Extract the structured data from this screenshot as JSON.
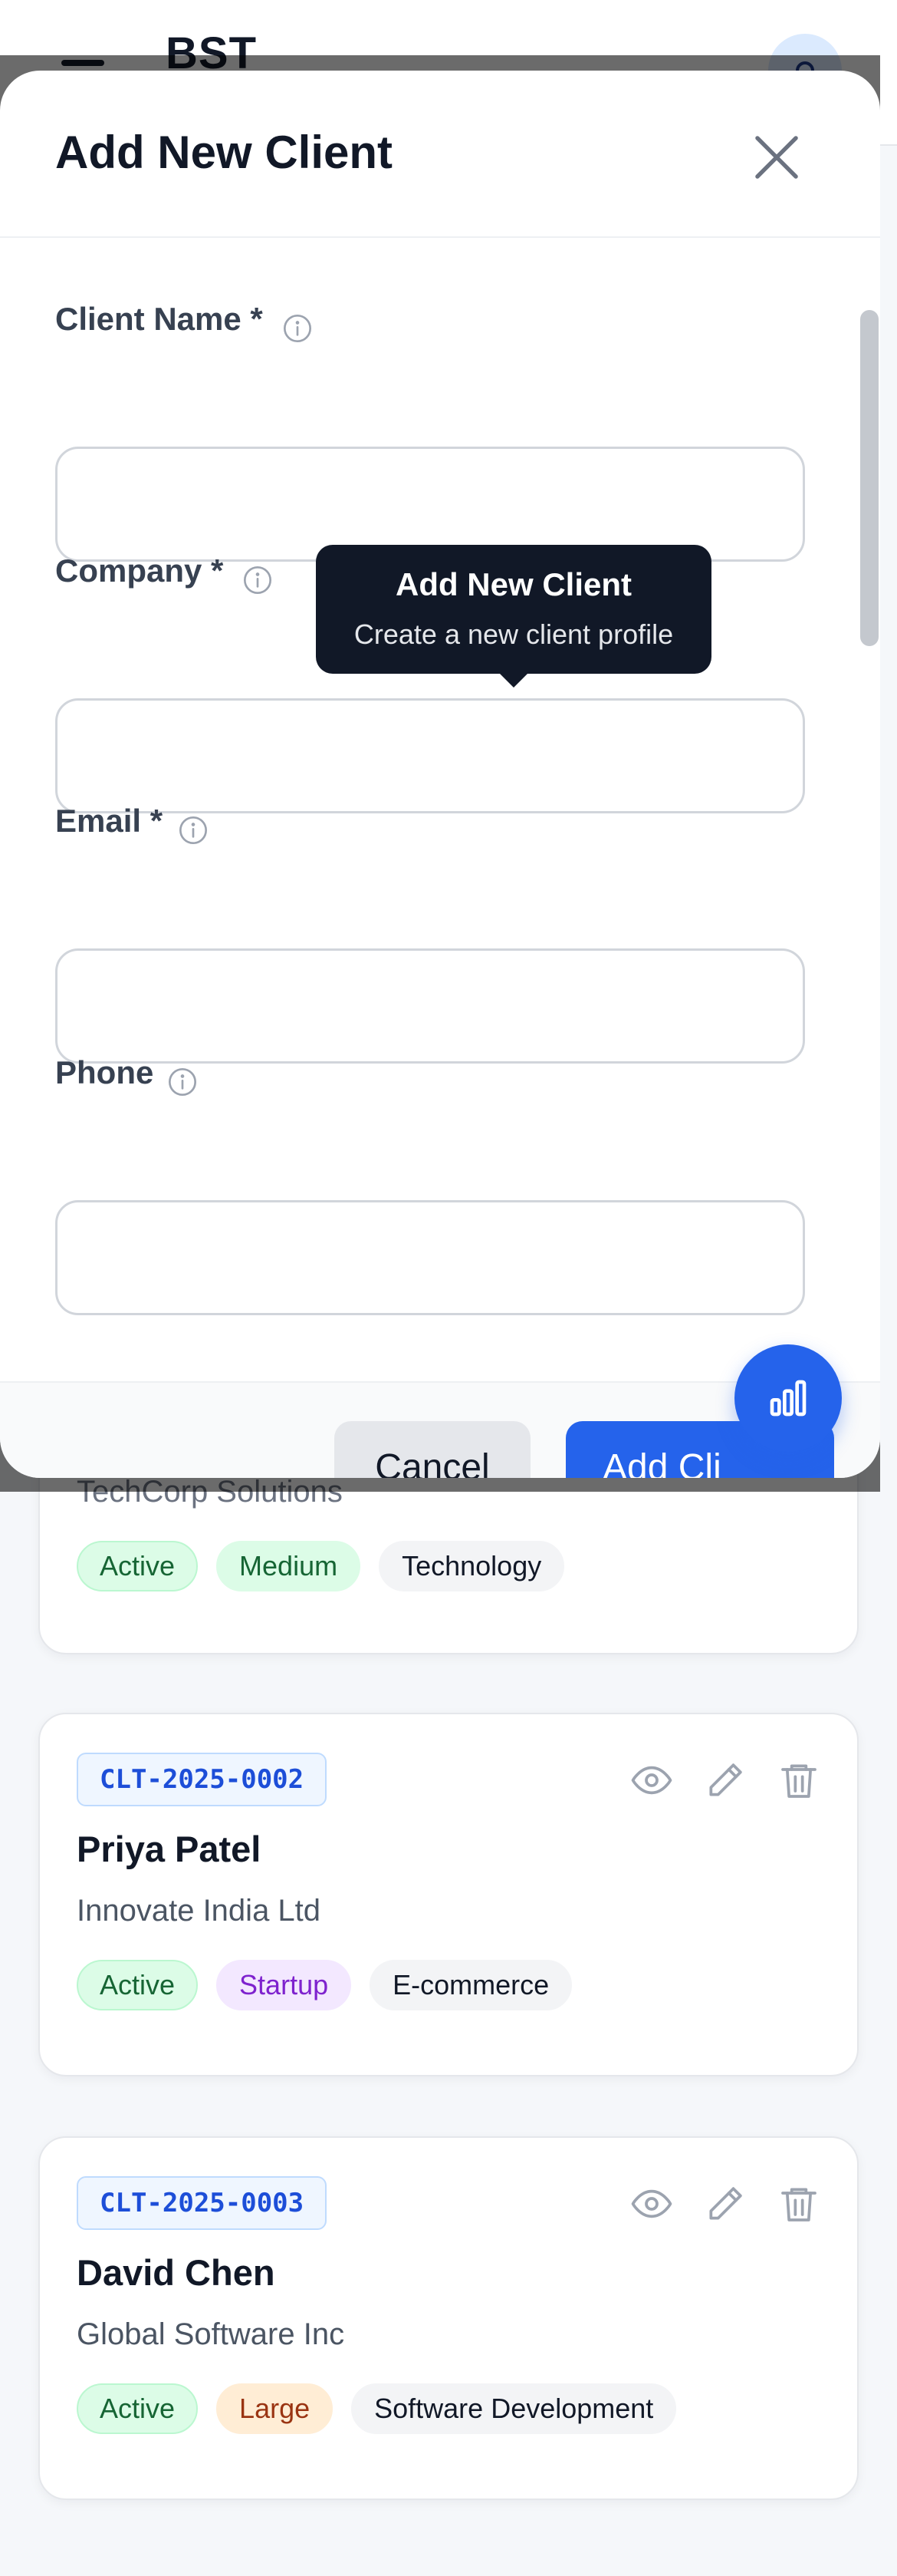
{
  "app": {
    "brand": "BST"
  },
  "modal": {
    "title": "Add New Client",
    "fields": [
      {
        "label": "Client Name *",
        "value": "",
        "placeholder": ""
      },
      {
        "label": "Company *",
        "value": "",
        "placeholder": ""
      },
      {
        "label": "Email *",
        "value": "",
        "placeholder": ""
      },
      {
        "label": "Phone",
        "value": "",
        "placeholder": ""
      }
    ],
    "tooltip": {
      "title": "Add New Client",
      "subtitle": "Create a new client profile"
    },
    "cancel_label": "Cancel",
    "submit_label": "Add Cli"
  },
  "clients": [
    {
      "id": "",
      "name": "",
      "company": "TechCorp Solutions",
      "tags": [
        "Active",
        "Medium",
        "Technology"
      ]
    },
    {
      "id": "CLT-2025-0002",
      "name": "Priya Patel",
      "company": "Innovate India Ltd",
      "tags": [
        "Active",
        "Startup",
        "E-commerce"
      ]
    },
    {
      "id": "CLT-2025-0003",
      "name": "David Chen",
      "company": "Global Software Inc",
      "tags": [
        "Active",
        "Large",
        "Software Development"
      ]
    }
  ],
  "colors": {
    "primary": "#2563eb",
    "tooltip_bg": "#111827",
    "active_tag": "#dcfce7",
    "startup_tag": "#f3e8ff",
    "large_tag": "#ffedd5"
  },
  "icons": {
    "menu": "hamburger-icon",
    "close": "close-icon",
    "info": "info-icon",
    "view": "eye-icon",
    "edit": "pencil-icon",
    "delete": "trash-icon",
    "fab": "bar-chart-icon"
  }
}
